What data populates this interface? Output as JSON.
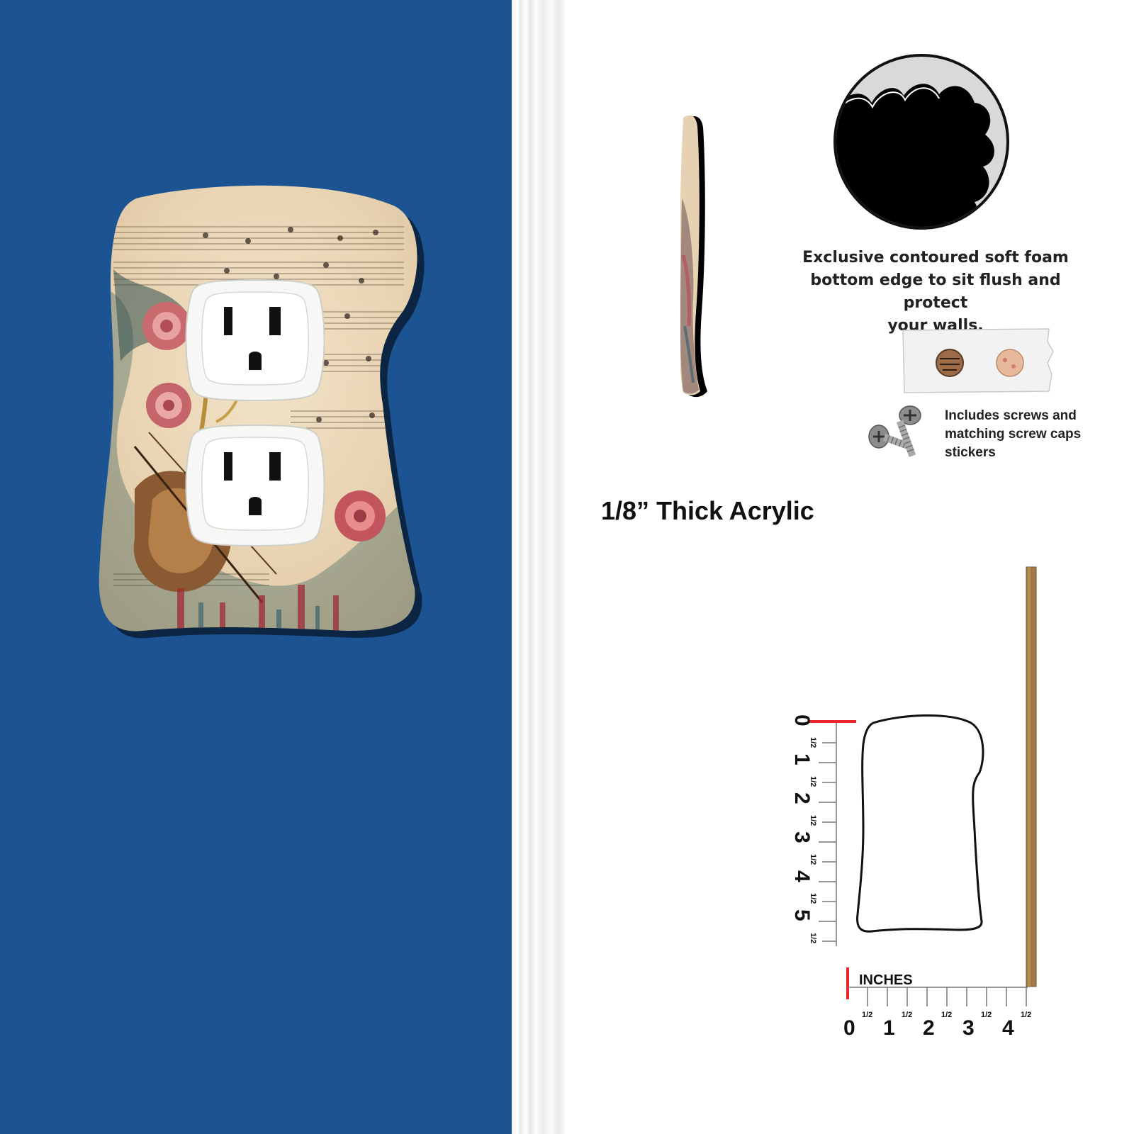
{
  "foam_feature": {
    "caption_lines": [
      "Exclusive contoured soft foam",
      "bottom edge to sit flush and protect",
      "your walls."
    ]
  },
  "hardware": {
    "caption_lines": [
      "Includes screws and",
      "matching screw caps",
      "stickers"
    ]
  },
  "material": {
    "thickness_label": "1/8” Thick Acrylic"
  },
  "ruler": {
    "unit_label": "INCHES",
    "vertical_numbers": [
      "0",
      "1",
      "2",
      "3",
      "4",
      "5"
    ],
    "horizontal_numbers": [
      "0",
      "1",
      "2",
      "3",
      "4"
    ],
    "half_mark": "1/2"
  },
  "colors": {
    "wall": "#1b5393",
    "ruler_zero": "#e8262b",
    "wood_side": "#a27a45",
    "plate_base": "#efdcc0"
  },
  "icons": {
    "outlet": "duplex-outlet-icon",
    "screw": "phillips-screw-icon"
  }
}
